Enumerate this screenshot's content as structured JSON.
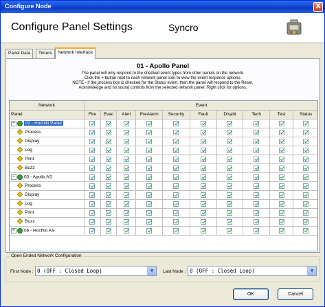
{
  "window": {
    "title": "Configure Node",
    "close_label": "X"
  },
  "header": {
    "heading": "Configure Panel Settings",
    "product": "Syncro",
    "icon": "panel-node-icon"
  },
  "tabs": [
    {
      "label": "Panel Data",
      "active": false
    },
    {
      "label": "Timers",
      "active": false
    },
    {
      "label": "Network Interface",
      "active": true
    }
  ],
  "panel": {
    "title": "01 - Apollo Panel",
    "description_lines": [
      "The panel will only respond to the checked event types from other panels on the network.",
      "Click the + button next to each network panel icon to view the event response options.",
      "NOTE - if the process box is checked for the Status event, then the panel will respond to the Reset,",
      "Acknowledge and no sound controls from the selected network panel. Right click for options."
    ]
  },
  "grid": {
    "group_headers": {
      "network": "Network",
      "event": "Event"
    },
    "panel_column_label": "Panel",
    "event_columns": [
      "Fire",
      "Evac",
      "Alert",
      "PreAlarm",
      "Security",
      "Fault",
      "Disabl",
      "Tech",
      "Test",
      "Status"
    ],
    "rows": [
      {
        "type": "panel",
        "label": "02 - Hochiki Panel",
        "expander": "−",
        "selected": true
      },
      {
        "type": "action",
        "label": "Process"
      },
      {
        "type": "action",
        "label": "Display"
      },
      {
        "type": "action",
        "label": "Log"
      },
      {
        "type": "action",
        "label": "Print"
      },
      {
        "type": "action",
        "label": "Buzz"
      },
      {
        "type": "panel",
        "label": "03 - Apollo AS",
        "expander": "−",
        "selected": false
      },
      {
        "type": "action",
        "label": "Process"
      },
      {
        "type": "action",
        "label": "Display"
      },
      {
        "type": "action",
        "label": "Log"
      },
      {
        "type": "action",
        "label": "Print"
      },
      {
        "type": "action",
        "label": "Buzz"
      },
      {
        "type": "panel",
        "label": "06 - Hochiki AS",
        "expander": "+",
        "selected": false
      }
    ]
  },
  "open_ended": {
    "legend": "Open Ended Network Configuration",
    "first_node_label": "First Node :",
    "first_node_value": "0 (OFF : Closed Loop)",
    "last_node_label": "Last Node :",
    "last_node_value": "0 (OFF : Closed Loop)"
  },
  "buttons": {
    "ok": "OK",
    "cancel": "Cancel"
  },
  "colors": {
    "title_bar": "#0b3bc5",
    "selection": "#316ac5",
    "check": "#21a121",
    "tab_highlight": "#f5a92f"
  }
}
